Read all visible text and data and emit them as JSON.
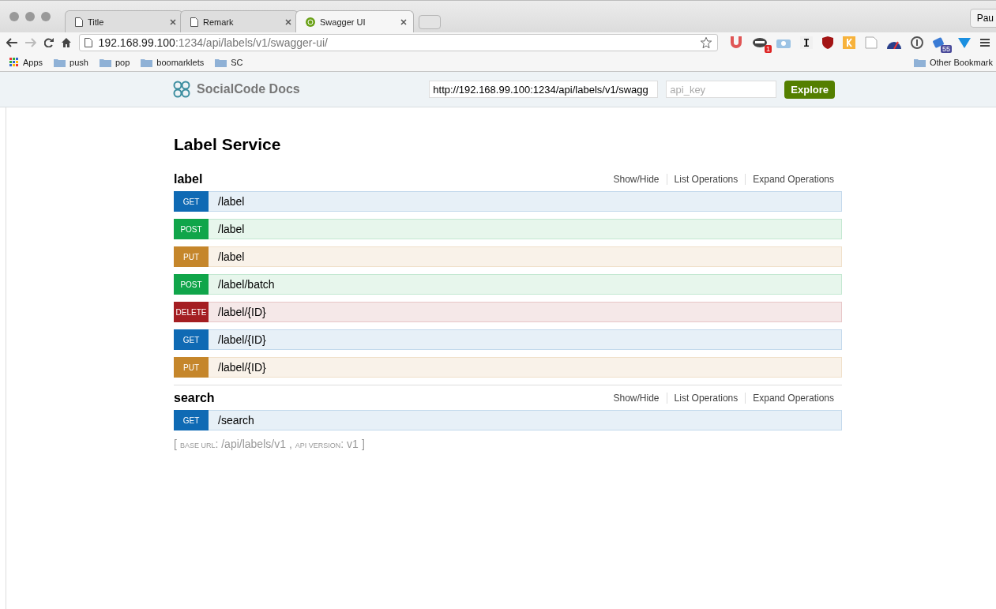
{
  "browser": {
    "tabs": [
      {
        "title": "Title",
        "kind": "page",
        "selected": false
      },
      {
        "title": "Remark",
        "kind": "page",
        "selected": false
      },
      {
        "title": "Swagger UI",
        "kind": "swagger",
        "selected": true
      }
    ],
    "profile": "Pau",
    "address": {
      "host": "192.168.99.100",
      "rest": ":1234/api/labels/v1/swagger-ui/"
    },
    "bookmarks": [
      {
        "label": "Apps",
        "kind": "apps"
      },
      {
        "label": "push",
        "kind": "folder"
      },
      {
        "label": "pop",
        "kind": "folder"
      },
      {
        "label": "boomarklets",
        "kind": "folder"
      },
      {
        "label": "SC",
        "kind": "folder"
      }
    ],
    "other_bookmarks": "Other Bookmark",
    "extension_badges": [
      "1",
      "55"
    ]
  },
  "header": {
    "brand": "SocialCode Docs",
    "url_value": "http://192.168.99.100:1234/api/labels/v1/swagg",
    "api_key_placeholder": "api_key",
    "explore": "Explore"
  },
  "title": "Label Service",
  "resources": [
    {
      "name": "label",
      "actions": [
        "Show/Hide",
        "List Operations",
        "Expand Operations"
      ],
      "operations": [
        {
          "method": "GET",
          "path": "/label"
        },
        {
          "method": "POST",
          "path": "/label"
        },
        {
          "method": "PUT",
          "path": "/label"
        },
        {
          "method": "POST",
          "path": "/label/batch"
        },
        {
          "method": "DELETE",
          "path": "/label/{ID}"
        },
        {
          "method": "GET",
          "path": "/label/{ID}"
        },
        {
          "method": "PUT",
          "path": "/label/{ID}"
        }
      ]
    },
    {
      "name": "search",
      "actions": [
        "Show/Hide",
        "List Operations",
        "Expand Operations"
      ],
      "operations": [
        {
          "method": "GET",
          "path": "/search"
        }
      ]
    }
  ],
  "footer": {
    "open": "[",
    "base_label": "BASE URL",
    "base_value": ": /api/labels/v1",
    "sep": ",",
    "version_label": "API VERSION",
    "version_value": ": v1",
    "close": "]"
  }
}
